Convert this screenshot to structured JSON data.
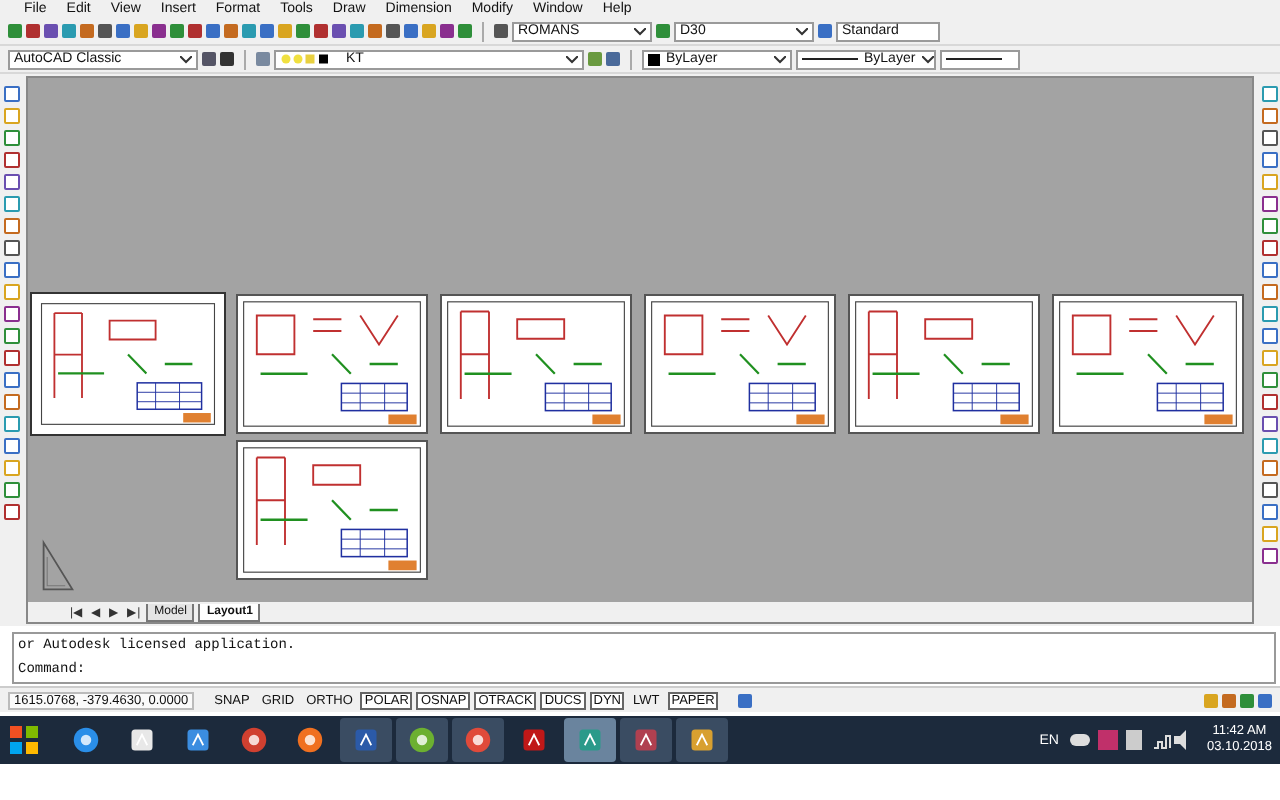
{
  "menu": [
    "File",
    "Edit",
    "View",
    "Insert",
    "Format",
    "Tools",
    "Draw",
    "Dimension",
    "Modify",
    "Window",
    "Help"
  ],
  "styles_toolbar": {
    "text_style": "ROMANS",
    "dim_style": "D30",
    "table_style": "Standard"
  },
  "workspace": "AutoCAD Classic",
  "layer": "KT",
  "properties": {
    "color_setting": "ByLayer",
    "linetype": "ByLayer"
  },
  "sheets": [
    {
      "selected": true
    },
    {
      "selected": false
    },
    {
      "selected": false
    },
    {
      "selected": false
    },
    {
      "selected": false
    },
    {
      "selected": false
    },
    {
      "selected": false
    }
  ],
  "tab_nav": [
    "|◀",
    "◀",
    "▶",
    "▶|"
  ],
  "layout_tabs": [
    {
      "label": "Model",
      "selected": false
    },
    {
      "label": "Layout1",
      "selected": true
    }
  ],
  "command_lines": [
    "or Autodesk licensed application.",
    "Command:"
  ],
  "status_bar": {
    "coordinates": "1615.0768, -379.4630, 0.0000",
    "toggles": [
      {
        "label": "SNAP",
        "on": false
      },
      {
        "label": "GRID",
        "on": false
      },
      {
        "label": "ORTHO",
        "on": false
      },
      {
        "label": "POLAR",
        "on": true
      },
      {
        "label": "OSNAP",
        "on": true
      },
      {
        "label": "OTRACK",
        "on": true
      },
      {
        "label": "DUCS",
        "on": true
      },
      {
        "label": "DYN",
        "on": true
      },
      {
        "label": "LWT",
        "on": false
      },
      {
        "label": "PAPER",
        "on": true
      }
    ]
  },
  "taskbar": {
    "apps": [
      {
        "kind": "globe",
        "running": false,
        "active": false
      },
      {
        "kind": "keyboard",
        "running": false,
        "active": false
      },
      {
        "kind": "folder",
        "running": false,
        "active": false
      },
      {
        "kind": "record",
        "running": false,
        "active": false
      },
      {
        "kind": "fox",
        "running": false,
        "active": false
      },
      {
        "kind": "word",
        "running": true,
        "active": false
      },
      {
        "kind": "ring",
        "running": true,
        "active": false
      },
      {
        "kind": "chrome",
        "running": true,
        "active": false
      },
      {
        "kind": "red",
        "running": false,
        "active": false
      },
      {
        "kind": "cad",
        "running": true,
        "active": true
      },
      {
        "kind": "disk",
        "running": true,
        "active": false
      },
      {
        "kind": "paint",
        "running": true,
        "active": false
      }
    ],
    "language": "EN",
    "time": "11:42 AM",
    "date": "03.10.2018"
  }
}
